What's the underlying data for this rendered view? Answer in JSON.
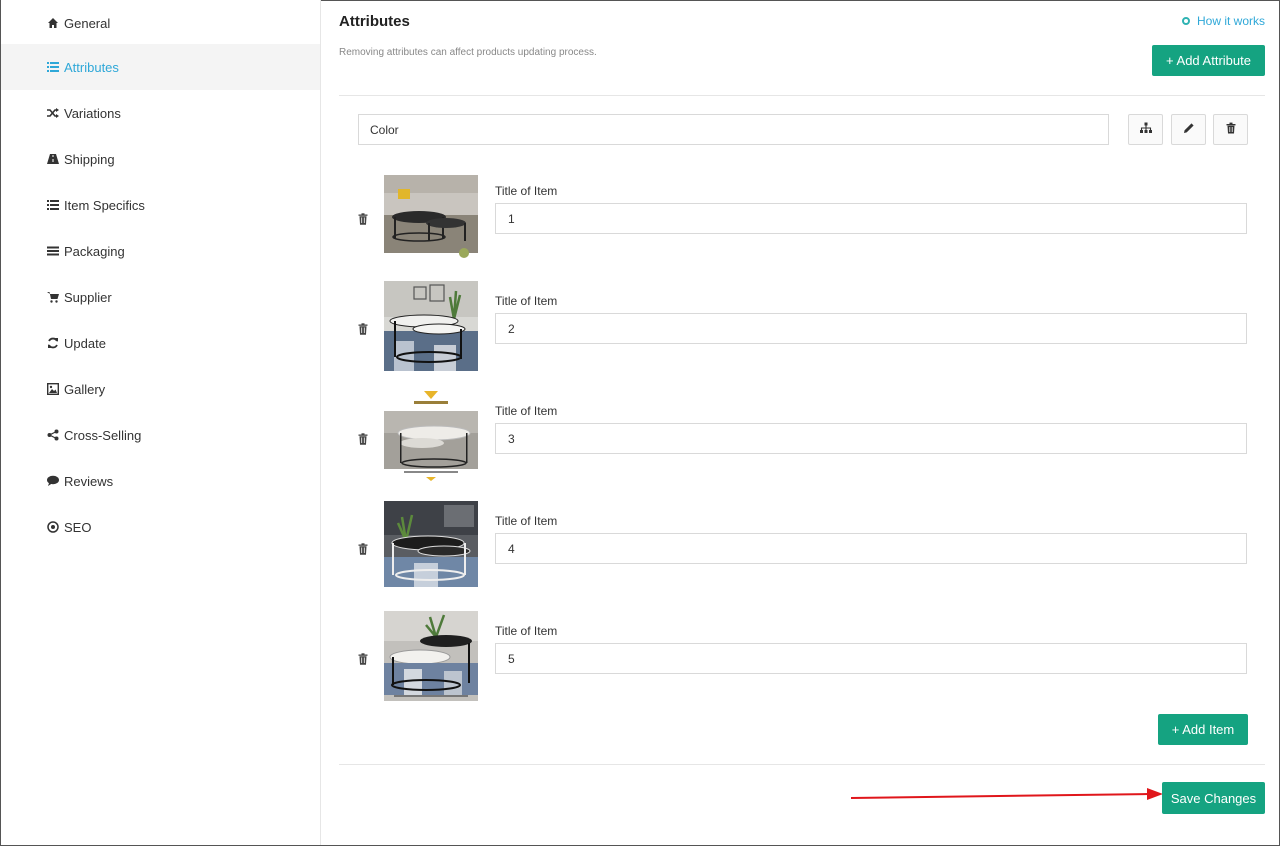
{
  "sidebar": {
    "items": [
      {
        "label": "General",
        "icon": "home-icon",
        "active": false
      },
      {
        "label": "Attributes",
        "icon": "list-icon",
        "active": true
      },
      {
        "label": "Variations",
        "icon": "shuffle-icon",
        "active": false
      },
      {
        "label": "Shipping",
        "icon": "road-icon",
        "active": false
      },
      {
        "label": "Item Specifics",
        "icon": "list-icon",
        "active": false
      },
      {
        "label": "Packaging",
        "icon": "bars-icon",
        "active": false
      },
      {
        "label": "Supplier",
        "icon": "cart-icon",
        "active": false
      },
      {
        "label": "Update",
        "icon": "refresh-icon",
        "active": false
      },
      {
        "label": "Gallery",
        "icon": "image-icon",
        "active": false
      },
      {
        "label": "Cross-Selling",
        "icon": "share-icon",
        "active": false
      },
      {
        "label": "Reviews",
        "icon": "comment-icon",
        "active": false
      },
      {
        "label": "SEO",
        "icon": "target-icon",
        "active": false
      }
    ]
  },
  "header": {
    "title": "Attributes",
    "subtitle": "Removing attributes can affect products updating process.",
    "how_link": "How it works",
    "add_attribute": "+ Add Attribute"
  },
  "attribute": {
    "name": "Color"
  },
  "items": [
    {
      "label": "Title of Item",
      "value": "1"
    },
    {
      "label": "Title of Item",
      "value": "2"
    },
    {
      "label": "Title of Item",
      "value": "3"
    },
    {
      "label": "Title of Item",
      "value": "4"
    },
    {
      "label": "Title of Item",
      "value": "5"
    }
  ],
  "footer": {
    "add_item": "+ Add Item",
    "save": "Save Changes"
  },
  "colors": {
    "accent_green": "#15a381",
    "link_blue": "#2fa8d8",
    "arrow_red": "#e0161b"
  }
}
